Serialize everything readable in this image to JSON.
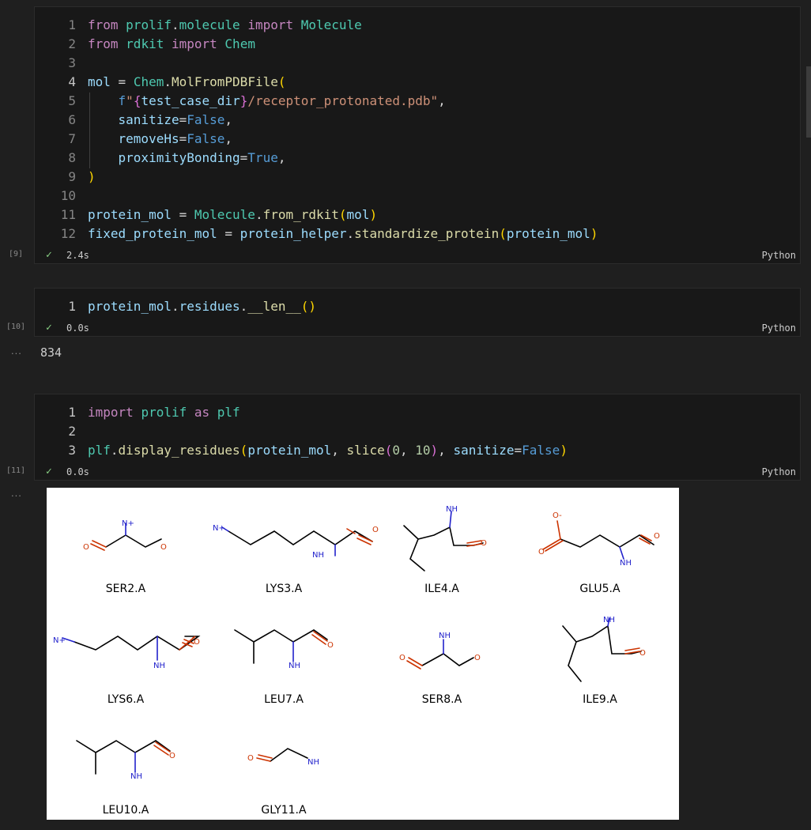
{
  "cells": [
    {
      "exec": "[9]",
      "time": "2.4s",
      "lang": "Python",
      "line_numbers": [
        "1",
        "2",
        "3",
        "4",
        "5",
        "6",
        "7",
        "8",
        "9",
        "10",
        "11",
        "12"
      ],
      "lines": [
        [
          [
            "kw",
            "from"
          ],
          [
            "plain",
            " "
          ],
          [
            "cls",
            "prolif"
          ],
          [
            "plain",
            "."
          ],
          [
            "cls",
            "molecule"
          ],
          [
            "plain",
            " "
          ],
          [
            "kw",
            "import"
          ],
          [
            "plain",
            " "
          ],
          [
            "cls",
            "Molecule"
          ]
        ],
        [
          [
            "kw",
            "from"
          ],
          [
            "plain",
            " "
          ],
          [
            "cls",
            "rdkit"
          ],
          [
            "plain",
            " "
          ],
          [
            "kw",
            "import"
          ],
          [
            "plain",
            " "
          ],
          [
            "cls",
            "Chem"
          ]
        ],
        [],
        [
          [
            "var",
            "mol"
          ],
          [
            "op",
            " = "
          ],
          [
            "cls",
            "Chem"
          ],
          [
            "plain",
            "."
          ],
          [
            "fn",
            "MolFromPDBFile"
          ],
          [
            "p1",
            "("
          ]
        ],
        [
          [
            "plain",
            "    "
          ],
          [
            "con",
            "f"
          ],
          [
            "str",
            "\""
          ],
          [
            "p2",
            "{"
          ],
          [
            "var",
            "test_case_dir"
          ],
          [
            "p2",
            "}"
          ],
          [
            "str",
            "/receptor_protonated.pdb\""
          ],
          [
            "plain",
            ","
          ]
        ],
        [
          [
            "plain",
            "    "
          ],
          [
            "var",
            "sanitize"
          ],
          [
            "op",
            "="
          ],
          [
            "con",
            "False"
          ],
          [
            "plain",
            ","
          ]
        ],
        [
          [
            "plain",
            "    "
          ],
          [
            "var",
            "removeHs"
          ],
          [
            "op",
            "="
          ],
          [
            "con",
            "False"
          ],
          [
            "plain",
            ","
          ]
        ],
        [
          [
            "plain",
            "    "
          ],
          [
            "var",
            "proximityBonding"
          ],
          [
            "op",
            "="
          ],
          [
            "con",
            "True"
          ],
          [
            "plain",
            ","
          ]
        ],
        [
          [
            "p1",
            ")"
          ]
        ],
        [],
        [
          [
            "var",
            "protein_mol"
          ],
          [
            "op",
            " = "
          ],
          [
            "cls",
            "Molecule"
          ],
          [
            "plain",
            "."
          ],
          [
            "fn",
            "from_rdkit"
          ],
          [
            "p1",
            "("
          ],
          [
            "var",
            "mol"
          ],
          [
            "p1",
            ")"
          ]
        ],
        [
          [
            "var",
            "fixed_protein_mol"
          ],
          [
            "op",
            " = "
          ],
          [
            "var",
            "protein_helper"
          ],
          [
            "plain",
            "."
          ],
          [
            "fn",
            "standardize_protein"
          ],
          [
            "p1",
            "("
          ],
          [
            "var",
            "protein_mol"
          ],
          [
            "p1",
            ")"
          ]
        ]
      ]
    },
    {
      "exec": "[10]",
      "time": "0.0s",
      "lang": "Python",
      "line_numbers": [
        "1"
      ],
      "lines": [
        [
          [
            "var",
            "protein_mol"
          ],
          [
            "plain",
            "."
          ],
          [
            "var",
            "residues"
          ],
          [
            "plain",
            "."
          ],
          [
            "fn",
            "__len__"
          ],
          [
            "p1",
            "()"
          ]
        ]
      ],
      "output": "834"
    },
    {
      "exec": "[11]",
      "time": "0.0s",
      "lang": "Python",
      "line_numbers": [
        "1",
        "2",
        "3"
      ],
      "lines": [
        [
          [
            "kw",
            "import"
          ],
          [
            "plain",
            " "
          ],
          [
            "cls",
            "prolif"
          ],
          [
            "plain",
            " "
          ],
          [
            "kw",
            "as"
          ],
          [
            "plain",
            " "
          ],
          [
            "cls",
            "plf"
          ]
        ],
        [],
        [
          [
            "cls",
            "plf"
          ],
          [
            "plain",
            "."
          ],
          [
            "fn",
            "display_residues"
          ],
          [
            "p1",
            "("
          ],
          [
            "var",
            "protein_mol"
          ],
          [
            "plain",
            ", "
          ],
          [
            "fn",
            "slice"
          ],
          [
            "p2",
            "("
          ],
          [
            "num",
            "0"
          ],
          [
            "plain",
            ", "
          ],
          [
            "num",
            "10"
          ],
          [
            "p2",
            ")"
          ],
          [
            "plain",
            ", "
          ],
          [
            "var",
            "sanitize"
          ],
          [
            "op",
            "="
          ],
          [
            "con",
            "False"
          ],
          [
            "p1",
            ")"
          ]
        ]
      ]
    }
  ],
  "output_dots": "...",
  "residues": [
    "SER2.A",
    "LYS3.A",
    "ILE4.A",
    "GLU5.A",
    "LYS6.A",
    "LEU7.A",
    "SER8.A",
    "ILE9.A",
    "LEU10.A",
    "GLY11.A"
  ],
  "atoms": {
    "n_plus": "N+",
    "nh": "NH",
    "o": "O",
    "o_minus": "O-"
  },
  "colors": {
    "background": "#1f1f1f",
    "cell": "#181818",
    "success": "#89d185",
    "nitrogen": "#2222cc",
    "oxygen": "#cc3300"
  }
}
